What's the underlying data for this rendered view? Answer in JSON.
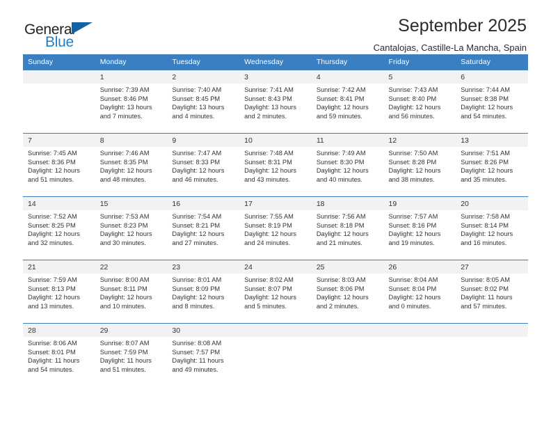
{
  "brand": {
    "name_part1": "General",
    "name_part2": "Blue",
    "accent_color": "#1f7fc4",
    "triangle_color": "#1263a5"
  },
  "header": {
    "title": "September 2025",
    "subtitle": "Cantalojas, Castille-La Mancha, Spain"
  },
  "calendar": {
    "header_bg": "#3a7fc1",
    "weekdays": [
      "Sunday",
      "Monday",
      "Tuesday",
      "Wednesday",
      "Thursday",
      "Friday",
      "Saturday"
    ],
    "weeks": [
      [
        {
          "day": "",
          "sunrise": "",
          "sunset": "",
          "daylight_a": "",
          "daylight_b": ""
        },
        {
          "day": "1",
          "sunrise": "Sunrise: 7:39 AM",
          "sunset": "Sunset: 8:46 PM",
          "daylight_a": "Daylight: 13 hours",
          "daylight_b": "and 7 minutes."
        },
        {
          "day": "2",
          "sunrise": "Sunrise: 7:40 AM",
          "sunset": "Sunset: 8:45 PM",
          "daylight_a": "Daylight: 13 hours",
          "daylight_b": "and 4 minutes."
        },
        {
          "day": "3",
          "sunrise": "Sunrise: 7:41 AM",
          "sunset": "Sunset: 8:43 PM",
          "daylight_a": "Daylight: 13 hours",
          "daylight_b": "and 2 minutes."
        },
        {
          "day": "4",
          "sunrise": "Sunrise: 7:42 AM",
          "sunset": "Sunset: 8:41 PM",
          "daylight_a": "Daylight: 12 hours",
          "daylight_b": "and 59 minutes."
        },
        {
          "day": "5",
          "sunrise": "Sunrise: 7:43 AM",
          "sunset": "Sunset: 8:40 PM",
          "daylight_a": "Daylight: 12 hours",
          "daylight_b": "and 56 minutes."
        },
        {
          "day": "6",
          "sunrise": "Sunrise: 7:44 AM",
          "sunset": "Sunset: 8:38 PM",
          "daylight_a": "Daylight: 12 hours",
          "daylight_b": "and 54 minutes."
        }
      ],
      [
        {
          "day": "7",
          "sunrise": "Sunrise: 7:45 AM",
          "sunset": "Sunset: 8:36 PM",
          "daylight_a": "Daylight: 12 hours",
          "daylight_b": "and 51 minutes."
        },
        {
          "day": "8",
          "sunrise": "Sunrise: 7:46 AM",
          "sunset": "Sunset: 8:35 PM",
          "daylight_a": "Daylight: 12 hours",
          "daylight_b": "and 48 minutes."
        },
        {
          "day": "9",
          "sunrise": "Sunrise: 7:47 AM",
          "sunset": "Sunset: 8:33 PM",
          "daylight_a": "Daylight: 12 hours",
          "daylight_b": "and 46 minutes."
        },
        {
          "day": "10",
          "sunrise": "Sunrise: 7:48 AM",
          "sunset": "Sunset: 8:31 PM",
          "daylight_a": "Daylight: 12 hours",
          "daylight_b": "and 43 minutes."
        },
        {
          "day": "11",
          "sunrise": "Sunrise: 7:49 AM",
          "sunset": "Sunset: 8:30 PM",
          "daylight_a": "Daylight: 12 hours",
          "daylight_b": "and 40 minutes."
        },
        {
          "day": "12",
          "sunrise": "Sunrise: 7:50 AM",
          "sunset": "Sunset: 8:28 PM",
          "daylight_a": "Daylight: 12 hours",
          "daylight_b": "and 38 minutes."
        },
        {
          "day": "13",
          "sunrise": "Sunrise: 7:51 AM",
          "sunset": "Sunset: 8:26 PM",
          "daylight_a": "Daylight: 12 hours",
          "daylight_b": "and 35 minutes."
        }
      ],
      [
        {
          "day": "14",
          "sunrise": "Sunrise: 7:52 AM",
          "sunset": "Sunset: 8:25 PM",
          "daylight_a": "Daylight: 12 hours",
          "daylight_b": "and 32 minutes."
        },
        {
          "day": "15",
          "sunrise": "Sunrise: 7:53 AM",
          "sunset": "Sunset: 8:23 PM",
          "daylight_a": "Daylight: 12 hours",
          "daylight_b": "and 30 minutes."
        },
        {
          "day": "16",
          "sunrise": "Sunrise: 7:54 AM",
          "sunset": "Sunset: 8:21 PM",
          "daylight_a": "Daylight: 12 hours",
          "daylight_b": "and 27 minutes."
        },
        {
          "day": "17",
          "sunrise": "Sunrise: 7:55 AM",
          "sunset": "Sunset: 8:19 PM",
          "daylight_a": "Daylight: 12 hours",
          "daylight_b": "and 24 minutes."
        },
        {
          "day": "18",
          "sunrise": "Sunrise: 7:56 AM",
          "sunset": "Sunset: 8:18 PM",
          "daylight_a": "Daylight: 12 hours",
          "daylight_b": "and 21 minutes."
        },
        {
          "day": "19",
          "sunrise": "Sunrise: 7:57 AM",
          "sunset": "Sunset: 8:16 PM",
          "daylight_a": "Daylight: 12 hours",
          "daylight_b": "and 19 minutes."
        },
        {
          "day": "20",
          "sunrise": "Sunrise: 7:58 AM",
          "sunset": "Sunset: 8:14 PM",
          "daylight_a": "Daylight: 12 hours",
          "daylight_b": "and 16 minutes."
        }
      ],
      [
        {
          "day": "21",
          "sunrise": "Sunrise: 7:59 AM",
          "sunset": "Sunset: 8:13 PM",
          "daylight_a": "Daylight: 12 hours",
          "daylight_b": "and 13 minutes."
        },
        {
          "day": "22",
          "sunrise": "Sunrise: 8:00 AM",
          "sunset": "Sunset: 8:11 PM",
          "daylight_a": "Daylight: 12 hours",
          "daylight_b": "and 10 minutes."
        },
        {
          "day": "23",
          "sunrise": "Sunrise: 8:01 AM",
          "sunset": "Sunset: 8:09 PM",
          "daylight_a": "Daylight: 12 hours",
          "daylight_b": "and 8 minutes."
        },
        {
          "day": "24",
          "sunrise": "Sunrise: 8:02 AM",
          "sunset": "Sunset: 8:07 PM",
          "daylight_a": "Daylight: 12 hours",
          "daylight_b": "and 5 minutes."
        },
        {
          "day": "25",
          "sunrise": "Sunrise: 8:03 AM",
          "sunset": "Sunset: 8:06 PM",
          "daylight_a": "Daylight: 12 hours",
          "daylight_b": "and 2 minutes."
        },
        {
          "day": "26",
          "sunrise": "Sunrise: 8:04 AM",
          "sunset": "Sunset: 8:04 PM",
          "daylight_a": "Daylight: 12 hours",
          "daylight_b": "and 0 minutes."
        },
        {
          "day": "27",
          "sunrise": "Sunrise: 8:05 AM",
          "sunset": "Sunset: 8:02 PM",
          "daylight_a": "Daylight: 11 hours",
          "daylight_b": "and 57 minutes."
        }
      ],
      [
        {
          "day": "28",
          "sunrise": "Sunrise: 8:06 AM",
          "sunset": "Sunset: 8:01 PM",
          "daylight_a": "Daylight: 11 hours",
          "daylight_b": "and 54 minutes."
        },
        {
          "day": "29",
          "sunrise": "Sunrise: 8:07 AM",
          "sunset": "Sunset: 7:59 PM",
          "daylight_a": "Daylight: 11 hours",
          "daylight_b": "and 51 minutes."
        },
        {
          "day": "30",
          "sunrise": "Sunrise: 8:08 AM",
          "sunset": "Sunset: 7:57 PM",
          "daylight_a": "Daylight: 11 hours",
          "daylight_b": "and 49 minutes."
        },
        {
          "day": "",
          "sunrise": "",
          "sunset": "",
          "daylight_a": "",
          "daylight_b": ""
        },
        {
          "day": "",
          "sunrise": "",
          "sunset": "",
          "daylight_a": "",
          "daylight_b": ""
        },
        {
          "day": "",
          "sunrise": "",
          "sunset": "",
          "daylight_a": "",
          "daylight_b": ""
        },
        {
          "day": "",
          "sunrise": "",
          "sunset": "",
          "daylight_a": "",
          "daylight_b": ""
        }
      ]
    ]
  }
}
